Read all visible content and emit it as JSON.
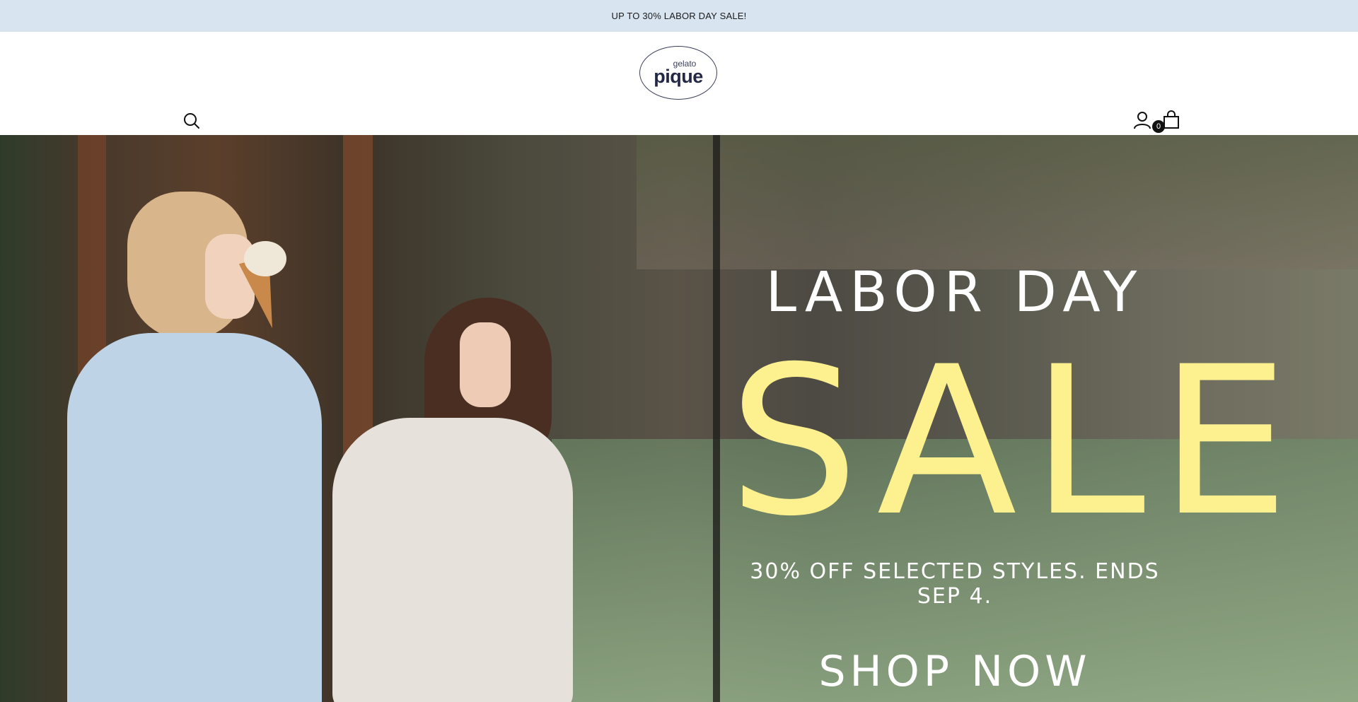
{
  "announcement": {
    "text": "UP TO 30% LABOR DAY SALE!"
  },
  "header": {
    "logo_small": "gelato",
    "logo_big": "pique",
    "icons": {
      "search": "search-icon",
      "account": "account-icon",
      "cart": "cart-icon"
    },
    "cart_count": "0"
  },
  "hero": {
    "line1": "LABOR DAY",
    "line2": "SALE",
    "line3": "30% OFF SELECTED STYLES. ENDS SEP 4.",
    "cta": "SHOP NOW",
    "accent_color": "#fdf08f"
  },
  "colors": {
    "announcement_bg": "#d8e5f1",
    "logo": "#232845"
  }
}
